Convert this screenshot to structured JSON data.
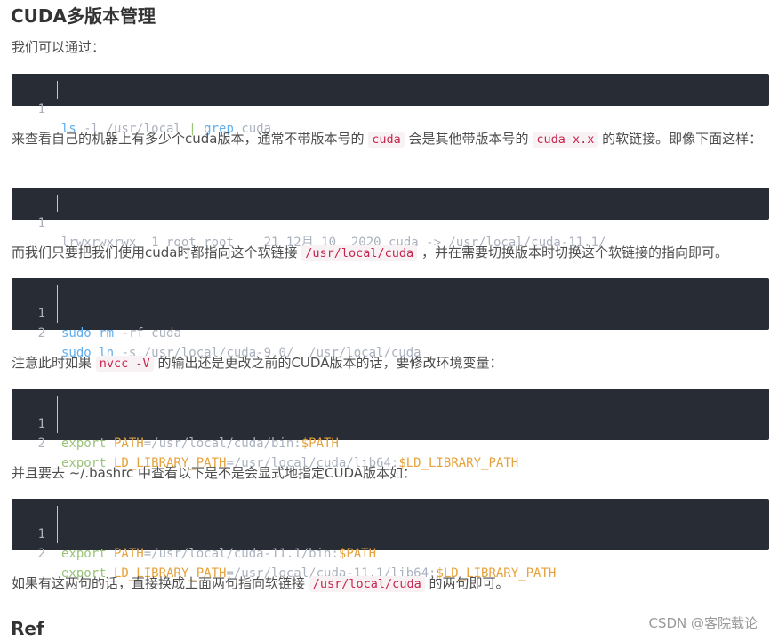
{
  "title": "CUDA多版本管理",
  "para1": "我们可以通过：",
  "block1": {
    "lines": [
      {
        "num": "1",
        "cmd": "ls",
        "args": " -l /usr/local ",
        "pipe": "|",
        "cmd2": " grep",
        "tail": " cuda"
      }
    ]
  },
  "para2": {
    "a": "来查看自己的机器上有多少个cuda版本，通常不带版本号的 ",
    "code1": "cuda",
    "b": " 会是其他带版本号的 ",
    "code2": "cuda-x.x",
    "c": " 的软链接。即像下面这样："
  },
  "block2": {
    "lines": [
      {
        "num": "1",
        "text": "lrwxrwxrwx  1 root root    21 12月 10  2020 cuda -> /usr/local/cuda-11.1/"
      }
    ]
  },
  "para3": {
    "a": "而我们只要把我们使用cuda时都指向这个软链接 ",
    "code1": "/usr/local/cuda",
    "b": " ，并在需要切换版本时切换这个软链接的指向即可。"
  },
  "block3": {
    "lines": [
      {
        "num": "1",
        "cmd": "sudo",
        "cmd2": " rm",
        "rest": " -rf cuda"
      },
      {
        "num": "2",
        "cmd": "sudo",
        "cmd2": " ln",
        "rest": " -s /usr/local/cuda-9.0/  /usr/local/cuda"
      }
    ]
  },
  "para4": {
    "a": "注意此时如果 ",
    "code1": "nvcc -V",
    "b": " 的输出还是更改之前的CUDA版本的话，要修改环境变量："
  },
  "block4": {
    "lines": [
      {
        "num": "1",
        "kw": "export",
        "var": " PATH",
        "eq": "=/usr/local/cuda/bin:",
        "ref": "$PATH"
      },
      {
        "num": "2",
        "kw": "export",
        "var": " LD_LIBRARY_PATH",
        "eq": "=/usr/local/cuda/lib64:",
        "ref": "$LD_LIBRARY_PATH"
      }
    ]
  },
  "para5": "并且要去 ~/.bashrc 中查看以下是不是会显式地指定CUDA版本如：",
  "block5": {
    "lines": [
      {
        "num": "1",
        "kw": "export",
        "var": " PATH",
        "eq": "=/usr/local/cuda-11.1/bin:",
        "ref": "$PATH"
      },
      {
        "num": "2",
        "kw": "export",
        "var": " LD_LIBRARY_PATH",
        "eq": "=/usr/local/cuda-11.1/lib64:",
        "ref": "$LD_LIBRARY_PATH"
      }
    ]
  },
  "para6": {
    "a": "如果有这两句的话，直接换成上面两句指向软链接 ",
    "code1": "/usr/local/cuda",
    "b": " 的两句即可。"
  },
  "ref_heading": "Ref",
  "watermark": "CSDN @客院载论"
}
